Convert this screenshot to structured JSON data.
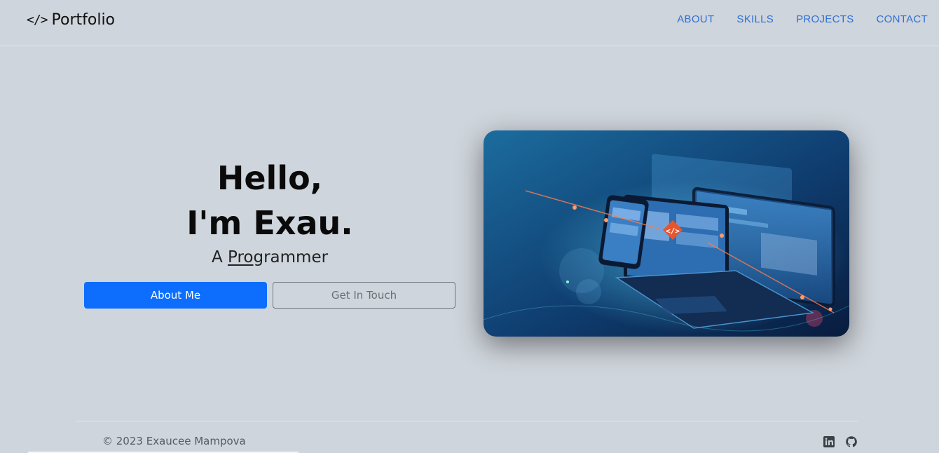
{
  "navbar": {
    "brand_icon": "</>",
    "brand_label": "Portfolio",
    "links": [
      "ABOUT",
      "SKILLS",
      "PROJECTS",
      "CONTACT"
    ]
  },
  "hero": {
    "greeting": "Hello,",
    "name_line": "I'm Exau.",
    "role_prefix": "A ",
    "role_typed": "Pro",
    "role_rest": "grammer",
    "primary_button": "About Me",
    "secondary_button": "Get In Touch",
    "image_icon": "code-laptop-illustration",
    "badge_icon": "</>"
  },
  "footer": {
    "copyright": "© 2023 Exaucee Mampova",
    "social_icons": [
      "linkedin-icon",
      "github-icon"
    ]
  },
  "colors": {
    "background": "#cfd5dc",
    "nav_link": "#2f6fd6",
    "primary": "#0d6efd",
    "badge": "#e8552d"
  }
}
